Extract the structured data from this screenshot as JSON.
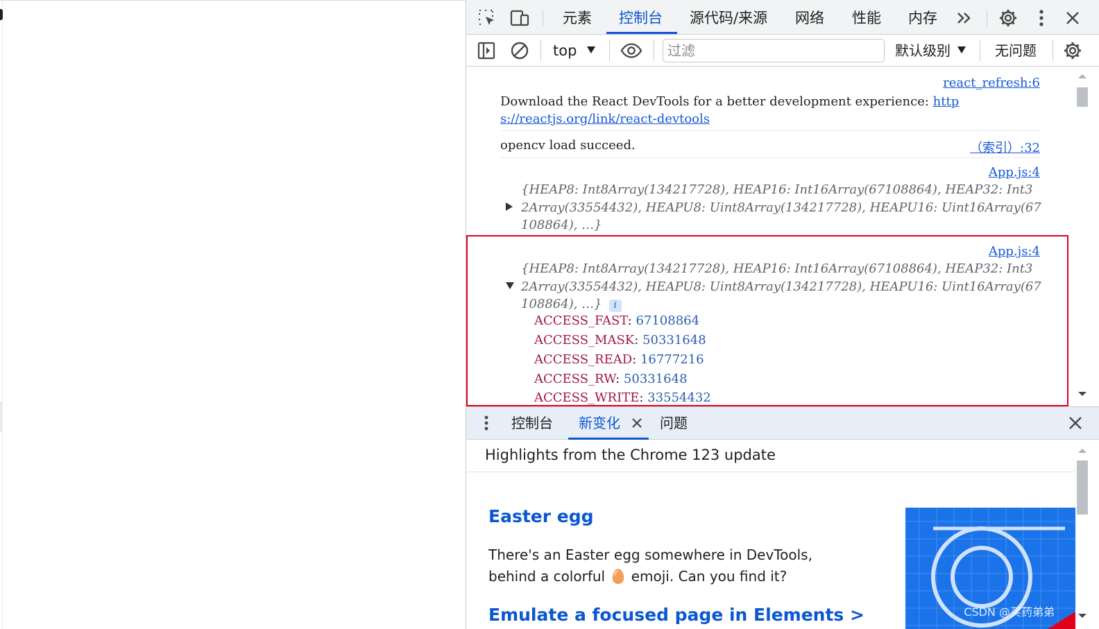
{
  "tabs": {
    "items": [
      "元素",
      "控制台",
      "源代码/来源",
      "网络",
      "性能",
      "内存"
    ],
    "active": "控制台",
    "more": "»"
  },
  "toolbar": {
    "context": "top",
    "filter_placeholder": "过滤",
    "level": "默认级别",
    "issues": "无问题"
  },
  "console": {
    "msg1_source": "react_refresh:6",
    "msg1_text": "Download the React DevTools for a better development experience: ",
    "msg1_link_a": "http",
    "msg1_link_b": "s://reactjs.org/link/react-devtools",
    "msg2_text": "opencv load succeed.",
    "msg2_source": "（索引）:32",
    "msg3_source": "App.js:4",
    "msg3_line1": "{HEAP8: Int8Array(134217728), HEAP16: Int16Array(67108864), HEAP32: Int3",
    "msg3_line2": "2Array(33554432), HEAPU8: Uint8Array(134217728), HEAPU16: Uint16Array(67",
    "msg3_line3": "108864), …}",
    "msg4_source": "App.js:4",
    "msg4_line1": "{HEAP8: Int8Array(134217728), HEAP16: Int16Array(67108864), HEAP32: Int3",
    "msg4_line2": "2Array(33554432), HEAPU8: Uint8Array(134217728), HEAPU16: Uint16Array(67",
    "msg4_line3": "108864), …}",
    "info_badge": "i",
    "props": [
      {
        "key": "ACCESS_FAST",
        "value": "67108864"
      },
      {
        "key": "ACCESS_MASK",
        "value": "50331648"
      },
      {
        "key": "ACCESS_READ",
        "value": "16777216"
      },
      {
        "key": "ACCESS_RW",
        "value": "50331648"
      },
      {
        "key": "ACCESS_WRITE",
        "value": "33554432"
      }
    ]
  },
  "drawer": {
    "tabs": [
      "控制台",
      "新变化",
      "问题"
    ],
    "active": "新变化",
    "heading": "Highlights from the Chrome 123 update",
    "feature1_title": "Easter egg",
    "feature1_desc1": "There's an Easter egg somewhere in DevTools,",
    "feature1_desc2": "behind a colorful 🥚 emoji. Can you find it?",
    "feature2_title": "Emulate a focused page in Elements >",
    "watermark": "CSDN @买药弟弟"
  },
  "colors": {
    "accent": "#0b57d0",
    "highlight_border": "#e0001b",
    "prop_key": "#a0174a",
    "prop_value": "#2a5db0"
  }
}
